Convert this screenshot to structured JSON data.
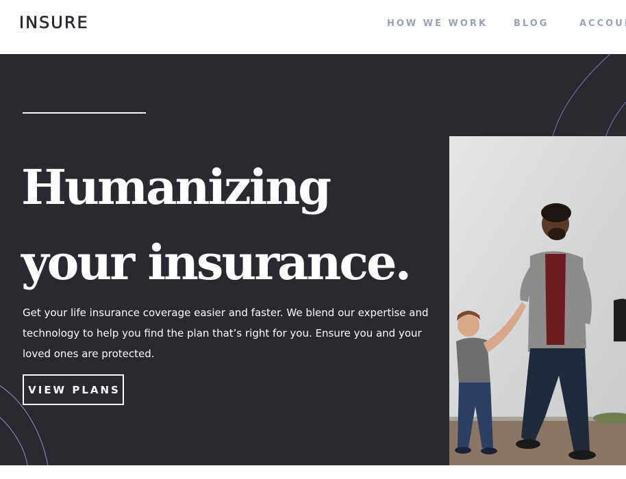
{
  "header": {
    "logo": "INSURE",
    "nav": [
      {
        "label": "HOW WE WORK"
      },
      {
        "label": "BLOG"
      },
      {
        "label": "ACCOUNT"
      }
    ]
  },
  "hero": {
    "title_line1": "Humanizing",
    "title_line2": "your insurance.",
    "description": "Get your life insurance coverage easier and faster. We blend our expertise and technology to help you find the plan that’s right for you. Ensure you and your loved ones are protected.",
    "cta_label": "VIEW PLANS",
    "image": "family-walking-photo"
  },
  "colors": {
    "hero_bg": "#2c2830",
    "nav_text": "#98a1b3",
    "logo_text": "#2c2830",
    "accent_line": "#6b7bb8"
  }
}
